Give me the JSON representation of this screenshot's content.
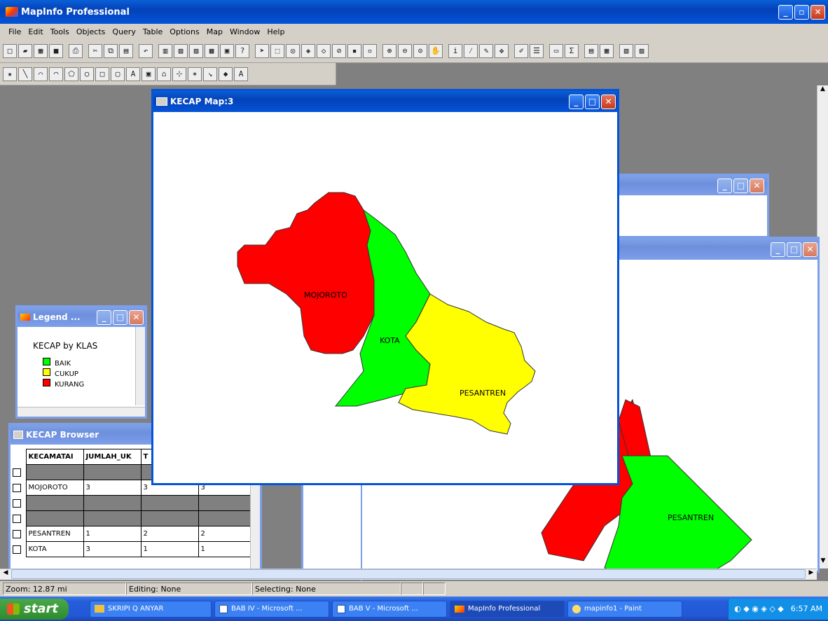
{
  "app": {
    "title": "MapInfo Professional"
  },
  "menu": [
    "File",
    "Edit",
    "Tools",
    "Objects",
    "Query",
    "Table",
    "Options",
    "Map",
    "Window",
    "Help"
  ],
  "map_window": {
    "title": "KECAP Map:3",
    "regions": [
      {
        "label": "MOJOROTO",
        "color": "#ff0000"
      },
      {
        "label": "KOTA",
        "color": "#00ff00"
      },
      {
        "label": "PESANTREN",
        "color": "#ffff00"
      }
    ]
  },
  "bg_map": {
    "label": "PESANTREN"
  },
  "legend_window": {
    "title": "Legend ...",
    "heading": "KECAP by KLAS",
    "items": [
      {
        "label": "BAIK",
        "color": "#00ff00"
      },
      {
        "label": "CUKUP",
        "color": "#ffff00"
      },
      {
        "label": "KURANG",
        "color": "#ff0000"
      }
    ]
  },
  "browser": {
    "title": "KECAP Browser",
    "columns": [
      "KECAMATAI",
      "JUMLAH_UK",
      "T"
    ],
    "rows": [
      [
        "",
        "",
        "",
        ""
      ],
      [
        "MOJOROTO",
        "3",
        "3",
        "3"
      ],
      [
        "",
        "",
        "",
        ""
      ],
      [
        "",
        "",
        "",
        ""
      ],
      [
        "PESANTREN",
        "1",
        "2",
        "2"
      ],
      [
        "KOTA",
        "3",
        "1",
        "1"
      ]
    ]
  },
  "status": {
    "zoom": "Zoom: 12.87 mi",
    "editing": "Editing: None",
    "selecting": "Selecting: None"
  },
  "taskbar": {
    "start": "start",
    "tasks": [
      "SKRIPI Q ANYAR",
      "BAB IV - Microsoft ...",
      "BAB V - Microsoft ...",
      "MapInfo Professional",
      "mapinfo1 - Paint"
    ],
    "clock": "6:57 AM"
  }
}
